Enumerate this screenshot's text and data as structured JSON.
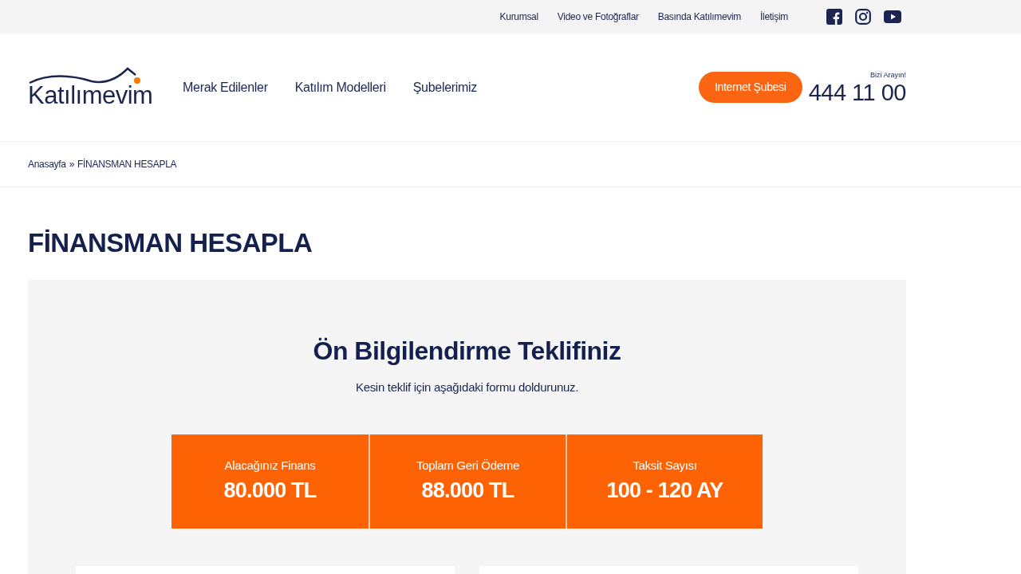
{
  "top_links": [
    "Kurumsal",
    "Video ve Fotoğraflar",
    "Basında Katılımevim",
    "İletişim"
  ],
  "logo": "Katılımevim",
  "nav": [
    "Merak Edilenler",
    "Katılım Modelleri",
    "Şubelerimiz"
  ],
  "cta": "Internet Şubesi",
  "phone_label": "Bizi Arayın!",
  "phone": "444 11 00",
  "breadcrumb": {
    "home": "Anasayfa",
    "separator": "»",
    "current": "FİNANSMAN HESAPLA"
  },
  "page_title": "FİNANSMAN HESAPLA",
  "offer": {
    "title": "Ön Bilgilendirme Teklifiniz",
    "subtitle": "Kesin teklif için aşağıdaki formu doldurunuz.",
    "stats": [
      {
        "label": "Alacağınız Finans",
        "value": "80.000 TL"
      },
      {
        "label": "Toplam Geri Ödeme",
        "value": "88.000 TL"
      },
      {
        "label": "Taksit Sayısı",
        "value": "100 - 120 AY"
      }
    ]
  }
}
